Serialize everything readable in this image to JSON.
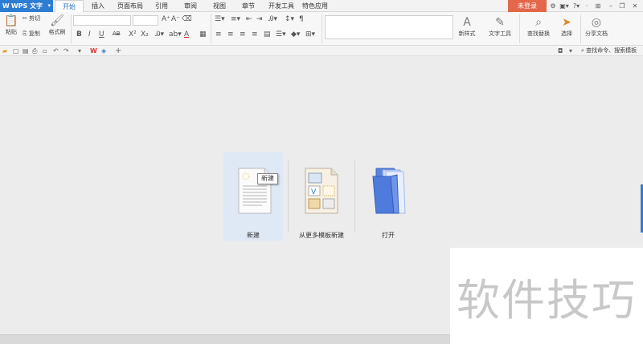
{
  "app": {
    "name": "WPS 文字",
    "logo": "W"
  },
  "menu_tabs": [
    "开始",
    "插入",
    "页面布局",
    "引用",
    "审阅",
    "视图",
    "章节",
    "开发工具",
    "特色应用"
  ],
  "login_label": "未登录",
  "ribbon": {
    "clipboard": {
      "paste": "粘贴",
      "cut": "剪切",
      "copy": "复制",
      "format_painter": "格式刷"
    },
    "font": {
      "bold": "B",
      "italic": "I",
      "underline": "U",
      "strike": "AB",
      "superscript": "X²",
      "subscript": "X₂",
      "grow": "A⁺",
      "shrink": "A⁻",
      "color": "A"
    },
    "new_style": "新样式",
    "text_tools": "文字工具",
    "find_replace": "查找替换",
    "select": "选择",
    "share_doc": "分享文档"
  },
  "quick_search_placeholder": "查找命令、搜索模板",
  "start_page": {
    "new": {
      "label": "新建"
    },
    "from_template": {
      "label": "从更多模板新建"
    },
    "open": {
      "label": "打开"
    },
    "tooltip": "新建"
  },
  "watermark_text": "软件技巧",
  "colors": {
    "accent": "#2d7dd2",
    "login": "#e2674b",
    "hover": "#dfe8f5"
  }
}
